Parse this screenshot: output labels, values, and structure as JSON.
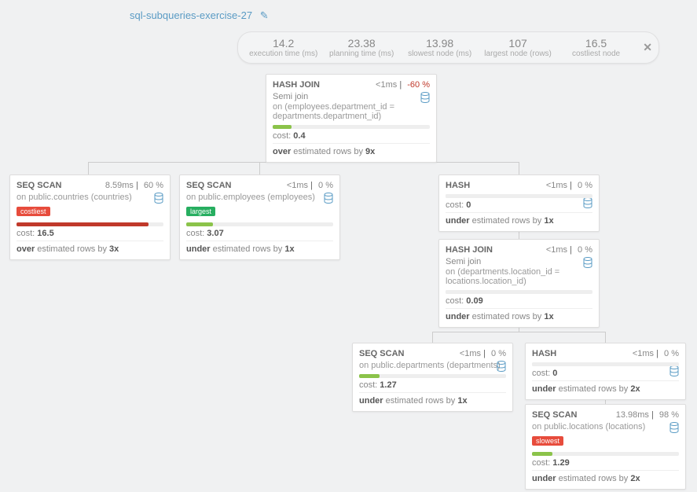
{
  "title": "sql-subqueries-exercise-27",
  "metrics": {
    "exec_v": "14.2",
    "exec_l": "execution time (ms)",
    "plan_v": "23.38",
    "plan_l": "planning time (ms)",
    "slow_v": "13.98",
    "slow_l": "slowest node (ms)",
    "large_v": "107",
    "large_l": "largest node (rows)",
    "cost_v": "16.5",
    "cost_l": "costliest node"
  },
  "nodes": {
    "root": {
      "title": "HASH JOIN",
      "time": "<1ms",
      "pct": "-60 %",
      "sub": "Semi join",
      "on": "on (employees.department_id = departments.department_id)",
      "cost_pref": "cost: ",
      "cost": "0.4",
      "est1": "over",
      "est2": " estimated rows by ",
      "est3": "9x",
      "barw": "12%",
      "barc": "#8bc34a"
    },
    "seqc": {
      "title": "SEQ SCAN",
      "time": "8.59ms",
      "pct": "60 %",
      "on": "on public.countries (countries)",
      "badge": "costliest",
      "cost_pref": "cost: ",
      "cost": "16.5",
      "est1": "over",
      "est2": " estimated rows by ",
      "est3": "3x",
      "barw": "90%",
      "barc": "#c0392b"
    },
    "seqe": {
      "title": "SEQ SCAN",
      "time": "<1ms",
      "pct": "0 %",
      "on": "on public.employees (employees)",
      "badge": "largest",
      "cost_pref": "cost: ",
      "cost": "3.07",
      "est1": "under",
      "est2": " estimated rows by ",
      "est3": "1x",
      "barw": "18%",
      "barc": "#8bc34a"
    },
    "hash1": {
      "title": "HASH",
      "time": "<1ms",
      "pct": "0 %",
      "cost_pref": "cost: ",
      "cost": "0",
      "est1": "under",
      "est2": " estimated rows by ",
      "est3": "1x",
      "barw": "2%",
      "barc": "#eee"
    },
    "hj2": {
      "title": "HASH JOIN",
      "time": "<1ms",
      "pct": "0 %",
      "sub": "Semi join",
      "on": "on (departments.location_id = locations.location_id)",
      "cost_pref": "cost: ",
      "cost": "0.09",
      "est1": "under",
      "est2": " estimated rows by ",
      "est3": "1x",
      "barw": "6%",
      "barc": "#eee"
    },
    "seqd": {
      "title": "SEQ SCAN",
      "time": "<1ms",
      "pct": "0 %",
      "on": "on public.departments (departments)",
      "cost_pref": "cost: ",
      "cost": "1.27",
      "est1": "under",
      "est2": " estimated rows by ",
      "est3": "1x",
      "barw": "14%",
      "barc": "#8bc34a"
    },
    "hash2": {
      "title": "HASH",
      "time": "<1ms",
      "pct": "0 %",
      "cost_pref": "cost: ",
      "cost": "0",
      "est1": "under",
      "est2": " estimated rows by ",
      "est3": "2x",
      "barw": "2%",
      "barc": "#eee"
    },
    "seql": {
      "title": "SEQ SCAN",
      "time": "13.98ms",
      "pct": "98 %",
      "on": "on public.locations (locations)",
      "badge": "slowest",
      "cost_pref": "cost: ",
      "cost": "1.29",
      "est1": "under",
      "est2": " estimated rows by ",
      "est3": "2x",
      "barw": "14%",
      "barc": "#8bc34a"
    }
  }
}
